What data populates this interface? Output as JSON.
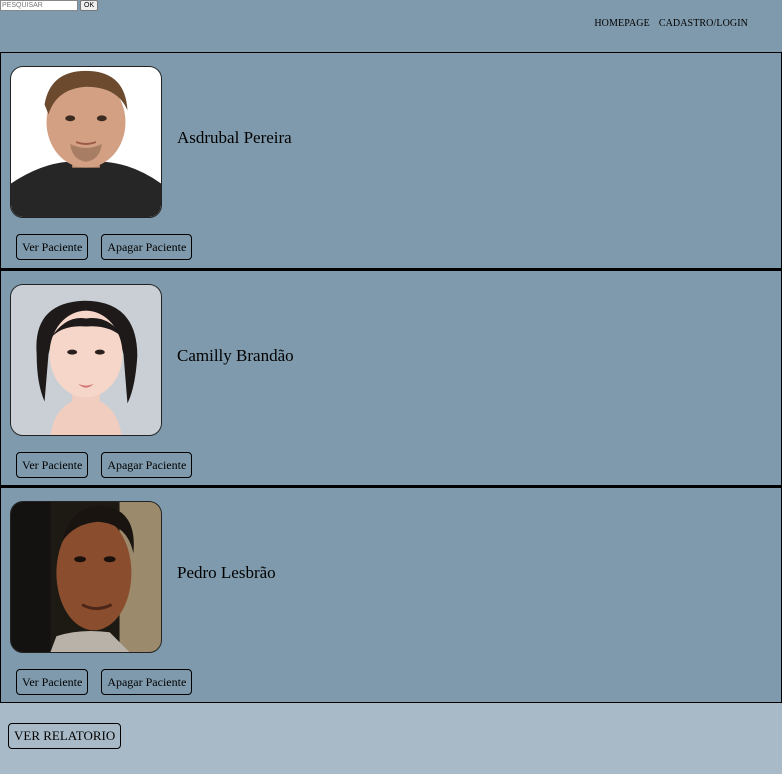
{
  "search": {
    "placeholder": "PESQUISAR",
    "button_label": "OK"
  },
  "nav": {
    "items": [
      {
        "label": "HOMEPAGE"
      },
      {
        "label": "CADASTRO/LOGIN"
      }
    ]
  },
  "patients": [
    {
      "name": "Asdrubal Pereira",
      "photo_icon": "patient-photo-1",
      "view_label": "Ver Paciente",
      "delete_label": "Apagar Paciente"
    },
    {
      "name": "Camilly Brandão",
      "photo_icon": "patient-photo-2",
      "view_label": "Ver Paciente",
      "delete_label": "Apagar Paciente"
    },
    {
      "name": "Pedro Lesbrão",
      "photo_icon": "patient-photo-3",
      "view_label": "Ver Paciente",
      "delete_label": "Apagar Paciente"
    }
  ],
  "footer": {
    "report_label": "VER RELATORIO"
  },
  "colors": {
    "header_bg": "#7f9aac",
    "page_bg": "#a8bac7"
  }
}
